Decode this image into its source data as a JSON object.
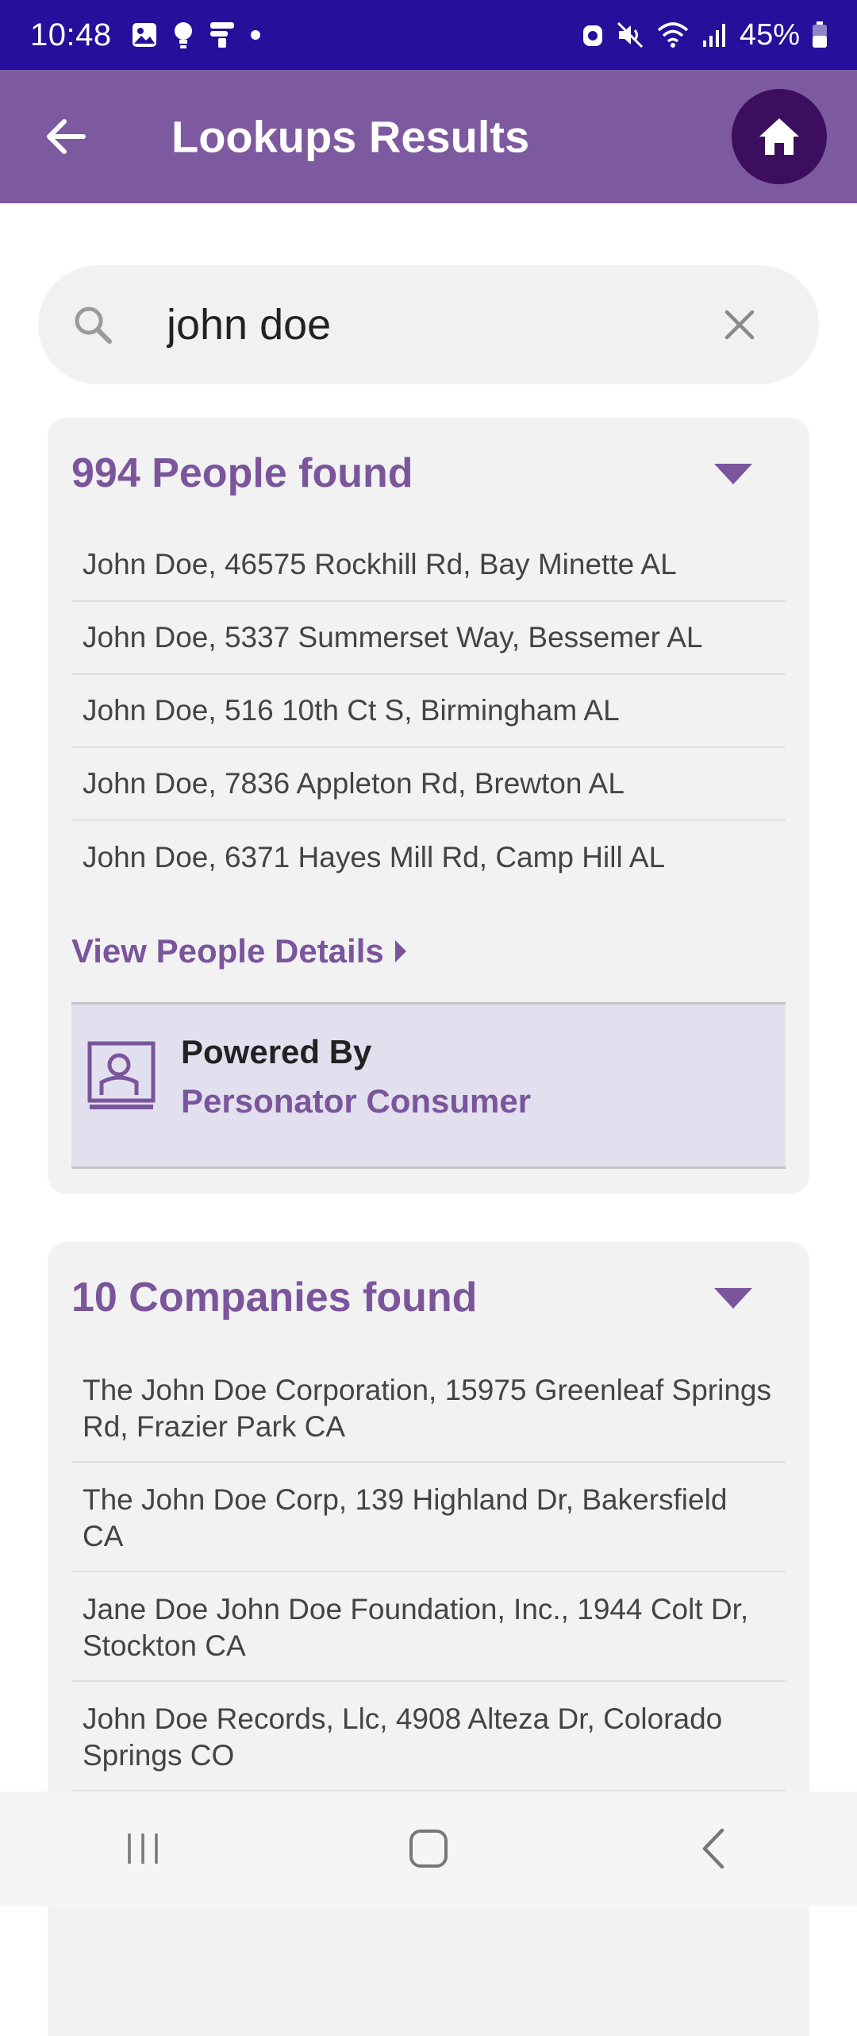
{
  "status_bar": {
    "time": "10:48",
    "battery": "45%"
  },
  "app_bar": {
    "title": "Lookups Results"
  },
  "search": {
    "value": "john doe"
  },
  "people": {
    "title": "994 People found",
    "items": [
      "John Doe, 46575 Rockhill Rd, Bay Minette AL",
      "John Doe, 5337 Summerset Way, Bessemer AL",
      "John Doe, 516 10th Ct S, Birmingham AL",
      "John Doe, 7836 Appleton Rd, Brewton AL",
      "John Doe, 6371 Hayes Mill Rd, Camp Hill AL"
    ],
    "view_details": "View People Details",
    "powered_by_label": "Powered By",
    "powered_by_name": "Personator Consumer"
  },
  "companies": {
    "title": "10 Companies found",
    "items": [
      "The John Doe Corporation, 15975 Greenleaf Springs Rd, Frazier Park CA",
      "The John Doe Corp, 139 Highland Dr, Bakersfield CA",
      "Jane Doe John Doe Foundation, Inc., 1944 Colt Dr, Stockton CA",
      "John Doe Records, Llc, 4908 Alteza Dr, Colorado Springs CO"
    ]
  },
  "colors": {
    "status_bar": "#24109a",
    "app_bar": "#7d5aa0",
    "accent": "#7b559c",
    "home_button": "#3b0f5e"
  },
  "icons": {
    "back": "arrow-left-icon",
    "home": "home-icon",
    "search": "search-icon",
    "clear": "close-icon"
  }
}
